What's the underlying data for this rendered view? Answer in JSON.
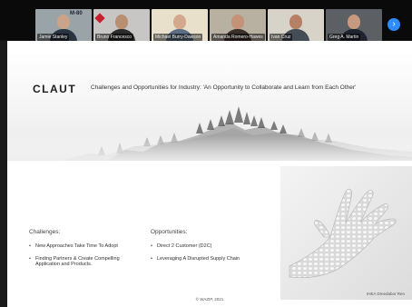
{
  "participants": [
    {
      "name": "Jamie Stanley",
      "bg": "#9aa3a8",
      "skin": "#c9a48a",
      "shirt": "#2a3440",
      "tag": ""
    },
    {
      "name": "Bruno Francesco",
      "bg": "#c8c6c4",
      "skin": "#b98f72",
      "shirt": "#2b2b2b",
      "tag": ""
    },
    {
      "name": "Michael Burry-Dawson",
      "bg": "#e9e0cc",
      "skin": "#d4a88c",
      "shirt": "#5c6d86",
      "tag": ""
    },
    {
      "name": "Amanda Romero-Hawes",
      "bg": "#b8b0a0",
      "skin": "#c49277",
      "shirt": "#3b2f2a",
      "tag": ""
    },
    {
      "name": "Ivan Cruz",
      "bg": "#d7d3c8",
      "skin": "#b58066",
      "shirt": "#444c56",
      "tag": ""
    },
    {
      "name": "Greg A. Martin",
      "bg": "#5c5f63",
      "skin": "#c59a80",
      "shirt": "#1f2430",
      "tag": ""
    }
  ],
  "strip_logo_text": "M-80",
  "next_icon": "›",
  "slide": {
    "logo": "CLAUT",
    "title": "Challenges and Opportunities for Industry: 'An Opportunity to Collaborate and Learn from Each Other'",
    "challenges_heading": "Challenges:",
    "challenges": [
      "New Approaches Take Time To Adopt",
      "Finding Partners & Create Compelling Application and Products."
    ],
    "opportunities_heading": "Opportunities:",
    "opportunities": [
      "Direct 2 Customer (D2C)",
      "Leveraging A Disrupted Supply Chain"
    ],
    "image_credit": "IHEA Dmedabor Ren",
    "footer": "© WAZIP, 2021"
  }
}
